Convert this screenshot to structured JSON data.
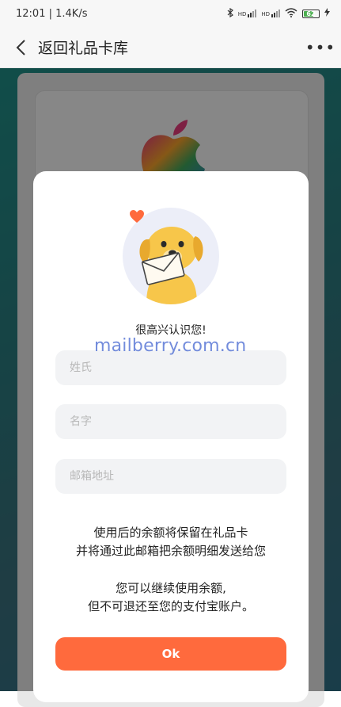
{
  "status_bar": {
    "time": "12:01",
    "speed": "1.4K/s",
    "network_labels": [
      "HD",
      "HD"
    ],
    "battery_level": "62"
  },
  "nav": {
    "back_title": "返回礼品卡库",
    "more_label": "•••"
  },
  "dialog": {
    "greeting": "很高兴认识您!",
    "watermark": "mailberry.com.cn",
    "fields": {
      "surname_placeholder": "姓氏",
      "name_placeholder": "名字",
      "email_placeholder": "邮箱地址",
      "surname_value": "",
      "name_value": "",
      "email_value": ""
    },
    "notice_line1": "使用后的余额将保留在礼品卡",
    "notice_line2": "并将通过此邮箱把余额明细发送给您",
    "notice_line3": "您可以继续使用余额,",
    "notice_line4": "但不可退还至您的支付宝账户。",
    "ok_label": "Ok"
  },
  "colors": {
    "accent": "#ff6a3d",
    "dog": "#f7c64a",
    "heart": "#ff6a3d",
    "watermark": "#5b78d6"
  }
}
